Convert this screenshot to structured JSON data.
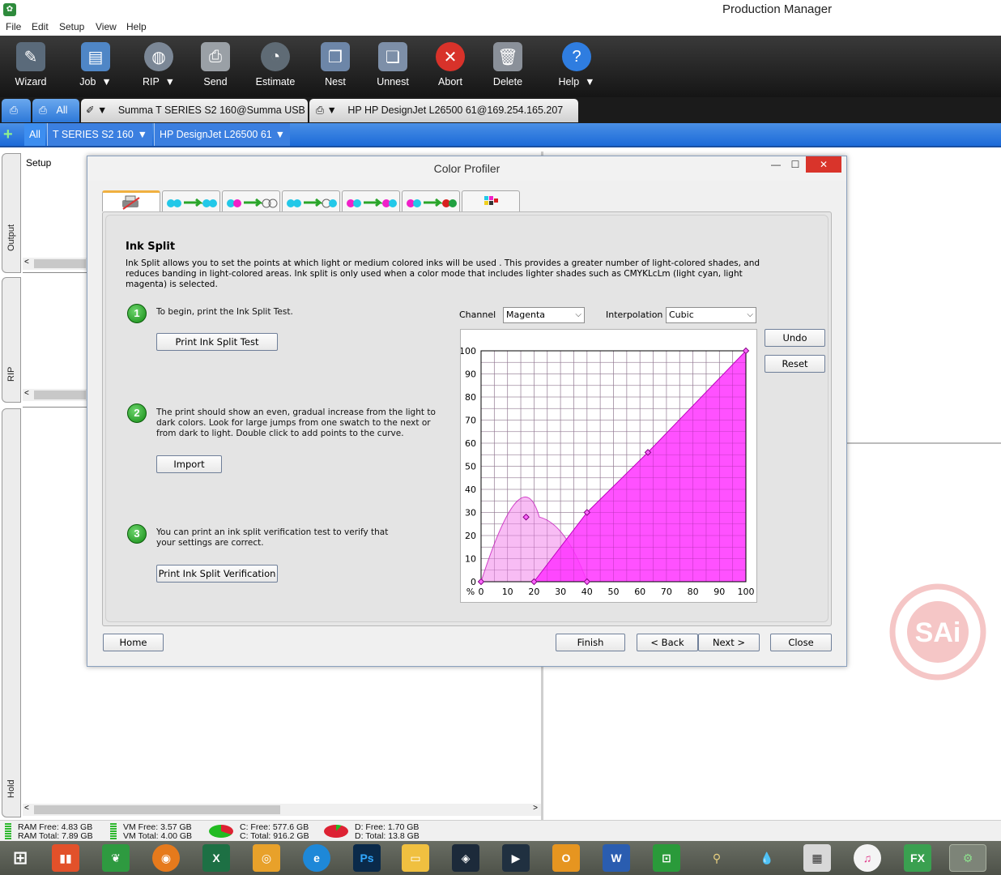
{
  "window": {
    "title": "Production Manager"
  },
  "menu": {
    "items": [
      "File",
      "Edit",
      "Setup",
      "View",
      "Help"
    ]
  },
  "toolbar": {
    "buttons": [
      {
        "label": "Wizard",
        "icon": "wizard-icon"
      },
      {
        "label": "Job",
        "icon": "folder-icon"
      },
      {
        "label": "RIP",
        "icon": "globe-icon"
      },
      {
        "label": "Send",
        "icon": "printer-icon"
      },
      {
        "label": "Estimate",
        "icon": "gauge-icon"
      },
      {
        "label": "Nest",
        "icon": "nest-icon"
      },
      {
        "label": "Unnest",
        "icon": "unnest-icon"
      },
      {
        "label": "Abort",
        "icon": "abort-icon"
      },
      {
        "label": "Delete",
        "icon": "trash-icon"
      },
      {
        "label": "Help",
        "icon": "help-icon"
      }
    ],
    "dropdown_glyph": "▼"
  },
  "tabs": {
    "all": "All",
    "device1": "Summa T SERIES S2 160@Summa USB",
    "device2": "HP HP DesignJet L26500 61@169.254.165.207"
  },
  "subtabs": {
    "plus": "+",
    "all": "All",
    "device1": "T SERIES S2 160",
    "device2": "HP DesignJet L26500 61"
  },
  "left_panels": {
    "output": "Output",
    "rip": "RIP",
    "hold": "Hold",
    "setup_header": "Setup"
  },
  "dialog": {
    "title": "Color Profiler",
    "minimize": "—",
    "maximize": "☐",
    "close": "✕",
    "heading": "Ink Split",
    "description": "Ink Split allows you to set the points at which light or medium colored inks will be used . This provides a greater number of light-colored shades, and reduces banding in light-colored areas. Ink split is only used when a color mode that includes lighter shades such as CMYKLcLm (light cyan, light magenta) is selected.",
    "steps": [
      {
        "number": "1",
        "text": "To begin, print the Ink Split Test.",
        "button": "Print Ink Split Test"
      },
      {
        "number": "2",
        "text": "The print should show an even, gradual increase from the light to dark colors. Look for large jumps from one swatch to the next or from dark to light. Double click to add points to the curve.",
        "button": "Import"
      },
      {
        "number": "3",
        "text": "You can print an ink split verification test to verify that your settings are correct.",
        "button": "Print Ink Split Verification"
      }
    ],
    "channel_label": "Channel",
    "channel_value": "Magenta",
    "interpolation_label": "Interpolation",
    "interpolation_value": "Cubic",
    "undo": "Undo",
    "reset": "Reset",
    "nav": {
      "home": "Home",
      "finish": "Finish",
      "back": "< Back",
      "next": "Next >",
      "close": "Close"
    }
  },
  "chart_data": {
    "type": "area",
    "x_unit_label": "%",
    "xlim": [
      0,
      100
    ],
    "ylim": [
      0,
      100
    ],
    "x_ticks": [
      0,
      10,
      20,
      30,
      40,
      50,
      60,
      70,
      80,
      90,
      100
    ],
    "y_ticks": [
      0,
      10,
      20,
      30,
      40,
      50,
      60,
      70,
      80,
      90,
      100
    ],
    "grid": true,
    "series": [
      {
        "color": "#f6a6f0",
        "points": [
          [
            0,
            0
          ],
          [
            17,
            28
          ],
          [
            40,
            0
          ]
        ]
      },
      {
        "color": "#ff33ff",
        "points": [
          [
            20,
            0
          ],
          [
            40,
            30
          ],
          [
            63,
            56
          ],
          [
            100,
            100
          ]
        ]
      }
    ]
  },
  "status": {
    "ram_free": "RAM Free: 4.83 GB",
    "ram_total": "RAM Total: 7.89 GB",
    "vm_free": "VM Free: 3.57 GB",
    "vm_total": "VM Total: 4.00 GB",
    "c_free": "C: Free: 577.6 GB",
    "c_total": "C: Total: 916.2 GB",
    "d_free": "D: Free: 1.70 GB",
    "d_total": "D: Total: 13.8 GB"
  },
  "watermark": "SAi",
  "taskbar": {
    "apps": [
      "start-icon",
      "equalizer-app-icon",
      "leaf-app-icon",
      "firefox-icon",
      "excel-icon",
      "camera-app-icon",
      "ie-icon",
      "photoshop-icon",
      "explorer-icon",
      "vectorworks-icon",
      "video-app-icon",
      "outlook-icon",
      "word-icon",
      "store-icon",
      "pin-app-icon",
      "drop-app-icon",
      "calculator-icon",
      "itunes-icon",
      "fx-app-icon",
      "production-manager-icon"
    ],
    "ps_text": "Ps",
    "w_text": "W",
    "x_text": "X",
    "fx_text": "FX"
  }
}
